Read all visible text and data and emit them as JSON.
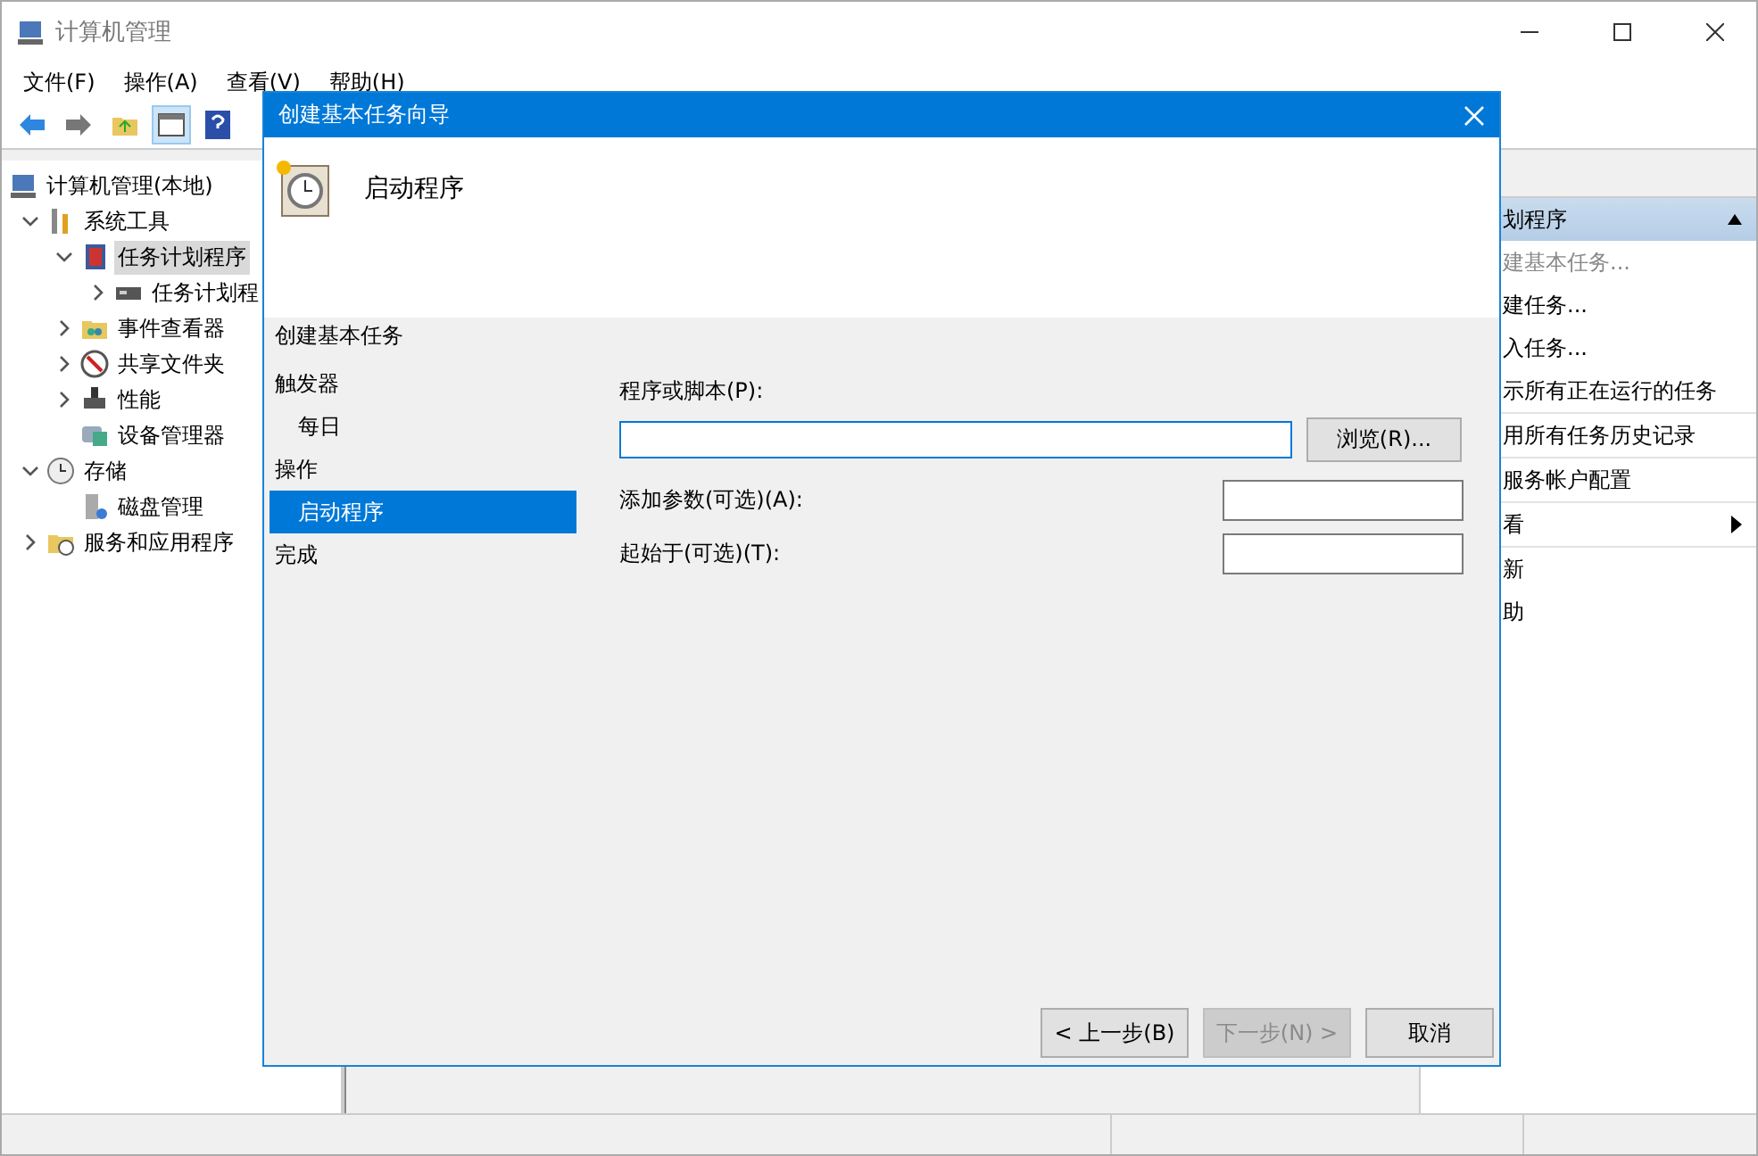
{
  "window": {
    "title": "计算机管理"
  },
  "menu": [
    "文件(F)",
    "操作(A)",
    "查看(V)",
    "帮助(H)"
  ],
  "tree": [
    {
      "label": "计算机管理(本地)",
      "selected": false,
      "children": [
        {
          "label": "系统工具",
          "expanded": true,
          "selected": false,
          "children": [
            {
              "label": "任务计划程序",
              "expanded": true,
              "selected": true,
              "children": [
                {
                  "label": "任务计划程",
                  "expanded": false,
                  "selected": false
                }
              ]
            },
            {
              "label": "事件查看器",
              "expanded": false,
              "selected": false
            },
            {
              "label": "共享文件夹",
              "expanded": false,
              "selected": false
            },
            {
              "label": "性能",
              "expanded": false,
              "selected": false
            },
            {
              "label": "设备管理器",
              "selected": false
            }
          ]
        },
        {
          "label": "存储",
          "expanded": true,
          "selected": false,
          "children": [
            {
              "label": "磁盘管理",
              "selected": false
            }
          ]
        },
        {
          "label": "服务和应用程序",
          "expanded": false,
          "selected": false
        }
      ]
    }
  ],
  "actions": {
    "header": "划程序",
    "items": [
      {
        "label": "建基本任务...",
        "disabled": true
      },
      {
        "label": "建任务...",
        "disabled": false
      },
      {
        "label": "入任务...",
        "disabled": false
      },
      {
        "label": "示所有正在运行的任务",
        "disabled": false
      },
      {
        "label": "用所有任务历史记录",
        "disabled": false,
        "separator": true
      },
      {
        "label": "服务帐户配置",
        "disabled": false,
        "separator": true
      },
      {
        "label": "看",
        "disabled": false,
        "submenu": true,
        "separator": true
      },
      {
        "label": "新",
        "disabled": false,
        "separator": true
      },
      {
        "label": "助",
        "disabled": false
      }
    ]
  },
  "dialog": {
    "title": "创建基本任务向导",
    "heading": "启动程序",
    "section": "创建基本任务",
    "steps": [
      {
        "label": "触发器",
        "selected": false,
        "children": [
          {
            "label": "每日",
            "selected": false
          }
        ]
      },
      {
        "label": "操作",
        "selected": false,
        "children": [
          {
            "label": "启动程序",
            "selected": true
          }
        ]
      },
      {
        "label": "完成",
        "selected": false
      }
    ],
    "program": {
      "label": "程序或脚本(P):",
      "focused": true,
      "browse": "浏览(R)..."
    },
    "fields": [
      {
        "label": "添加参数(可选)(A):"
      },
      {
        "label": "起始于(可选)(T):"
      }
    ],
    "buttons": [
      {
        "label": "< 上一步(B)",
        "disabled": false
      },
      {
        "label": "下一步(N) >",
        "disabled": true
      },
      {
        "label": "取消",
        "disabled": false
      }
    ]
  }
}
